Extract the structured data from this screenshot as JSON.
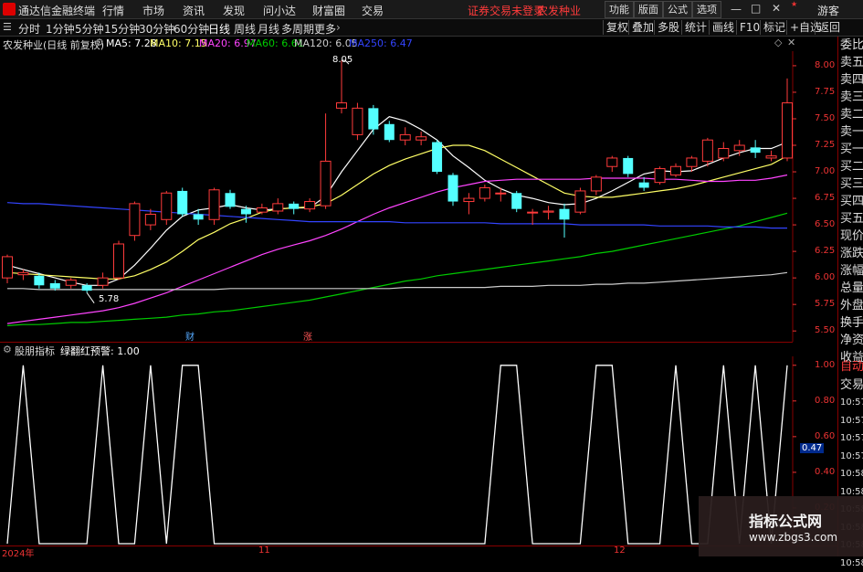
{
  "titlebar": {
    "app": "通达信金融终端",
    "menus": [
      "行情",
      "市场",
      "资讯",
      "发现",
      "问小达",
      "财富圈",
      "交易"
    ],
    "notice": "证券交易未登录",
    "stock": "农发种业",
    "buttons": [
      "功能",
      "版面",
      "公式",
      "选项"
    ],
    "guest": "游客"
  },
  "periods": [
    "分时",
    "1分钟",
    "5分钟",
    "15分钟",
    "30分钟",
    "60分钟",
    "日线",
    "周线",
    "月线",
    "多周期",
    "更多"
  ],
  "selected_period": "日线",
  "right_buttons": [
    "复权",
    "叠加",
    "多股",
    "统计",
    "画线",
    "F10",
    "标记",
    "+自选",
    "返回"
  ],
  "main_info": {
    "name": "农发种业(日线 前复权)",
    "ma5": "MA5: 7.28",
    "ma10": "MA10: 7.15",
    "ma20": "MA20: 6.97",
    "ma60": "MA60: 6.61",
    "ma120": "MA120: 6.05",
    "ma250": "MA250: 6.47"
  },
  "annotations": {
    "high": "8.05",
    "low": "5.78",
    "cai": "财",
    "zhang": "涨"
  },
  "indicator": {
    "name": "股朋指标",
    "label": "绿翻红预警: 1.00",
    "current": "0.47"
  },
  "right_panel": [
    "委比",
    "卖五",
    "卖四",
    "卖三",
    "卖二",
    "卖一",
    "买一",
    "买二",
    "买三",
    "买四",
    "买五",
    "现价",
    "涨跌",
    "涨幅",
    "总量",
    "外盘",
    "换手",
    "净资",
    "收益",
    "自动",
    "交易",
    "10:57",
    "10:57",
    "10:57",
    "10:57",
    "10:58",
    "10:58",
    "10:58",
    "10:58",
    "10:58",
    "10:58"
  ],
  "x_labels": [
    "2024年",
    "11",
    "12"
  ],
  "colors": {
    "up": "#ff3b3b",
    "down": "#54ffff",
    "ma5": "#ffffff",
    "ma10": "#ffff66",
    "ma20": "#ff44ff",
    "ma60": "#00cc00",
    "ma120": "#cccccc",
    "ma250": "#3344ff"
  },
  "watermark": {
    "t1": "指标公式网",
    "t2": "www.zbgs3.com"
  },
  "chart_data": {
    "type": "candlestick",
    "ylim": [
      5.45,
      8.12
    ],
    "yticks": [
      8.0,
      7.75,
      7.5,
      7.25,
      7.0,
      6.75,
      6.5,
      6.25,
      6.0,
      5.75,
      5.5
    ],
    "candles": [
      [
        6.0,
        6.2,
        6.22,
        5.95
      ],
      [
        6.03,
        6.05,
        6.08,
        5.98
      ],
      [
        6.02,
        5.93,
        6.05,
        5.9
      ],
      [
        5.95,
        5.9,
        5.98,
        5.88
      ],
      [
        5.93,
        5.98,
        6.0,
        5.9
      ],
      [
        5.93,
        5.88,
        5.95,
        5.86
      ],
      [
        5.93,
        6.0,
        6.05,
        5.9
      ],
      [
        6.0,
        6.32,
        6.35,
        5.98
      ],
      [
        6.4,
        6.7,
        6.72,
        6.35
      ],
      [
        6.5,
        6.6,
        6.65,
        6.45
      ],
      [
        6.55,
        6.8,
        6.82,
        6.5
      ],
      [
        6.82,
        6.6,
        6.85,
        6.58
      ],
      [
        6.6,
        6.55,
        6.65,
        6.5
      ],
      [
        6.55,
        6.83,
        6.85,
        6.5
      ],
      [
        6.8,
        6.67,
        6.83,
        6.65
      ],
      [
        6.65,
        6.6,
        6.68,
        6.52
      ],
      [
        6.62,
        6.66,
        6.7,
        6.6
      ],
      [
        6.63,
        6.7,
        6.75,
        6.6
      ],
      [
        6.7,
        6.65,
        6.72,
        6.6
      ],
      [
        6.65,
        6.72,
        6.75,
        6.62
      ],
      [
        6.68,
        7.1,
        7.55,
        6.65
      ],
      [
        7.6,
        7.65,
        8.05,
        7.55
      ],
      [
        7.35,
        7.6,
        7.65,
        7.3
      ],
      [
        7.6,
        7.4,
        7.63,
        7.35
      ],
      [
        7.45,
        7.3,
        7.48,
        7.28
      ],
      [
        7.3,
        7.35,
        7.42,
        7.25
      ],
      [
        7.3,
        7.33,
        7.38,
        7.25
      ],
      [
        7.28,
        7.0,
        7.3,
        6.98
      ],
      [
        6.97,
        6.72,
        6.99,
        6.68
      ],
      [
        6.72,
        6.75,
        6.8,
        6.6
      ],
      [
        6.75,
        6.85,
        6.88,
        6.72
      ],
      [
        6.8,
        6.8,
        6.85,
        6.72
      ],
      [
        6.8,
        6.65,
        6.82,
        6.62
      ],
      [
        6.62,
        6.62,
        6.65,
        6.5
      ],
      [
        6.62,
        6.63,
        6.68,
        6.55
      ],
      [
        6.65,
        6.55,
        6.7,
        6.38
      ],
      [
        6.62,
        6.82,
        6.85,
        6.6
      ],
      [
        6.82,
        6.95,
        6.97,
        6.78
      ],
      [
        7.05,
        7.13,
        7.15,
        7.0
      ],
      [
        7.13,
        6.98,
        7.15,
        6.95
      ],
      [
        6.9,
        6.85,
        6.95,
        6.82
      ],
      [
        6.9,
        7.03,
        7.05,
        6.88
      ],
      [
        6.97,
        7.05,
        7.08,
        6.95
      ],
      [
        7.05,
        7.13,
        7.15,
        7.0
      ],
      [
        7.1,
        7.3,
        7.32,
        7.05
      ],
      [
        7.13,
        7.22,
        7.28,
        7.1
      ],
      [
        7.2,
        7.25,
        7.3,
        7.15
      ],
      [
        7.23,
        7.18,
        7.3,
        7.13
      ],
      [
        7.13,
        7.15,
        7.2,
        7.1
      ],
      [
        7.13,
        7.65,
        7.88,
        7.1
      ]
    ],
    "ma_series": [
      {
        "name": "MA5",
        "values": [
          6.12,
          6.08,
          6.04,
          6.0,
          5.96,
          5.93,
          5.93,
          5.99,
          6.12,
          6.28,
          6.45,
          6.58,
          6.64,
          6.66,
          6.69,
          6.66,
          6.64,
          6.65,
          6.66,
          6.66,
          6.77,
          7.0,
          7.2,
          7.4,
          7.52,
          7.48,
          7.4,
          7.3,
          7.15,
          7.04,
          6.92,
          6.84,
          6.78,
          6.75,
          6.71,
          6.69,
          6.7,
          6.75,
          6.82,
          6.9,
          6.98,
          7.01,
          7.0,
          7.01,
          7.07,
          7.13,
          7.18,
          7.22,
          7.22,
          7.28
        ]
      },
      {
        "name": "MA10",
        "values": [
          6.05,
          6.04,
          6.03,
          6.02,
          6.01,
          6.0,
          5.99,
          5.99,
          6.02,
          6.08,
          6.15,
          6.25,
          6.36,
          6.43,
          6.51,
          6.56,
          6.62,
          6.65,
          6.66,
          6.67,
          6.7,
          6.78,
          6.88,
          6.98,
          7.06,
          7.12,
          7.17,
          7.22,
          7.25,
          7.25,
          7.2,
          7.12,
          7.04,
          6.96,
          6.88,
          6.8,
          6.77,
          6.76,
          6.76,
          6.78,
          6.8,
          6.82,
          6.84,
          6.87,
          6.91,
          6.95,
          6.99,
          7.03,
          7.07,
          7.15
        ]
      },
      {
        "name": "MA20",
        "values": [
          5.57,
          5.59,
          5.61,
          5.63,
          5.65,
          5.67,
          5.69,
          5.72,
          5.76,
          5.81,
          5.86,
          5.92,
          5.98,
          6.04,
          6.1,
          6.16,
          6.22,
          6.27,
          6.31,
          6.35,
          6.4,
          6.46,
          6.53,
          6.6,
          6.66,
          6.71,
          6.76,
          6.81,
          6.85,
          6.88,
          6.91,
          6.92,
          6.93,
          6.93,
          6.93,
          6.93,
          6.93,
          6.94,
          6.94,
          6.94,
          6.94,
          6.93,
          6.93,
          6.92,
          6.91,
          6.91,
          6.92,
          6.92,
          6.94,
          6.97
        ]
      },
      {
        "name": "MA60",
        "values": [
          5.55,
          5.56,
          5.56,
          5.57,
          5.58,
          5.58,
          5.59,
          5.6,
          5.61,
          5.62,
          5.63,
          5.65,
          5.66,
          5.68,
          5.69,
          5.71,
          5.73,
          5.75,
          5.77,
          5.79,
          5.82,
          5.85,
          5.88,
          5.91,
          5.94,
          5.97,
          5.99,
          6.02,
          6.04,
          6.06,
          6.08,
          6.1,
          6.12,
          6.14,
          6.16,
          6.18,
          6.2,
          6.23,
          6.25,
          6.28,
          6.31,
          6.34,
          6.37,
          6.4,
          6.43,
          6.46,
          6.49,
          6.53,
          6.57,
          6.61
        ]
      },
      {
        "name": "MA120",
        "values": [
          5.9,
          5.9,
          5.89,
          5.89,
          5.89,
          5.89,
          5.89,
          5.89,
          5.89,
          5.89,
          5.89,
          5.89,
          5.89,
          5.89,
          5.9,
          5.9,
          5.9,
          5.9,
          5.9,
          5.9,
          5.9,
          5.9,
          5.9,
          5.9,
          5.9,
          5.91,
          5.91,
          5.91,
          5.91,
          5.91,
          5.91,
          5.92,
          5.92,
          5.92,
          5.93,
          5.93,
          5.93,
          5.94,
          5.94,
          5.95,
          5.95,
          5.96,
          5.97,
          5.98,
          5.99,
          6.0,
          6.01,
          6.02,
          6.03,
          6.05
        ]
      },
      {
        "name": "MA250",
        "values": [
          6.71,
          6.7,
          6.7,
          6.69,
          6.68,
          6.67,
          6.66,
          6.65,
          6.64,
          6.63,
          6.62,
          6.61,
          6.6,
          6.59,
          6.58,
          6.57,
          6.56,
          6.55,
          6.54,
          6.53,
          6.53,
          6.53,
          6.53,
          6.53,
          6.53,
          6.52,
          6.52,
          6.52,
          6.52,
          6.52,
          6.52,
          6.51,
          6.51,
          6.51,
          6.51,
          6.51,
          6.5,
          6.5,
          6.5,
          6.5,
          6.5,
          6.49,
          6.49,
          6.49,
          6.49,
          6.48,
          6.48,
          6.48,
          6.47,
          6.47
        ]
      }
    ],
    "indicator_ylim": [
      0,
      1.05
    ],
    "indicator_yticks": [
      1.0,
      0.8,
      0.6,
      0.4,
      0.2
    ],
    "indicator_values": [
      0,
      1,
      0,
      0,
      0,
      0,
      1,
      0,
      0,
      1,
      0,
      1,
      1,
      0,
      0,
      0,
      0,
      0,
      0,
      0,
      0,
      0,
      0,
      0,
      0,
      0,
      0,
      0,
      0,
      0,
      0,
      1,
      1,
      0,
      0,
      0,
      0,
      1,
      1,
      0,
      0,
      0,
      1,
      0,
      0,
      1,
      0,
      1,
      0,
      1
    ]
  }
}
